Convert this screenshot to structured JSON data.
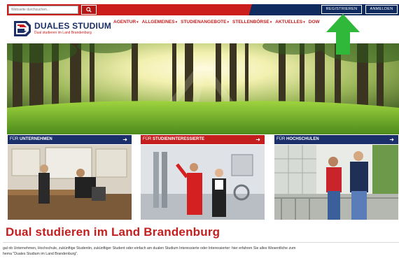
{
  "search": {
    "placeholder": "Webseite durchsuchen..."
  },
  "topbar": {
    "register_label": "REGISTRIEREN",
    "login_label": "ANMELDEN"
  },
  "logo": {
    "title": "DUALES STUDIUM",
    "subtitle": "Dual studieren im Land Brandenburg"
  },
  "nav": {
    "items": [
      {
        "label": "AGENTUR"
      },
      {
        "label": "ALLGEMEINES"
      },
      {
        "label": "STUDIENANGEBOTE"
      },
      {
        "label": "STELLENBÖRSE"
      },
      {
        "label": "AKTUELLES"
      },
      {
        "label": "DOW"
      }
    ]
  },
  "tiles": [
    {
      "prefix": "FÜR",
      "label": "UNTERNEHMEN",
      "color": "#1b2f6b"
    },
    {
      "prefix": "FÜR",
      "label": "STUDIENINTERESSIERTE",
      "color": "#c41e1e"
    },
    {
      "prefix": "FÜR",
      "label": "HOCHSCHULEN",
      "color": "#1b2f6b"
    }
  ],
  "main": {
    "title": "Dual studieren im Land Brandenburg",
    "intro_line1": "gal ob Unternehmen, Hochschule, zukünftige Studentin, zukünftiger Student oder einfach am dualen Studium Interessierte oder Interessierter: hier erfahren Sie alles Wesentliche zum",
    "intro_line2": "hema \"Duales Studium im Land Brandenburg\"."
  },
  "colors": {
    "brand_red": "#c41e1e",
    "brand_blue": "#1b2f6b",
    "arrow_green": "#2fb83a"
  },
  "icons": [
    "search-icon",
    "chevron-down-icon",
    "arrow-right-icon",
    "logo-icon",
    "green-arrow-icon"
  ]
}
